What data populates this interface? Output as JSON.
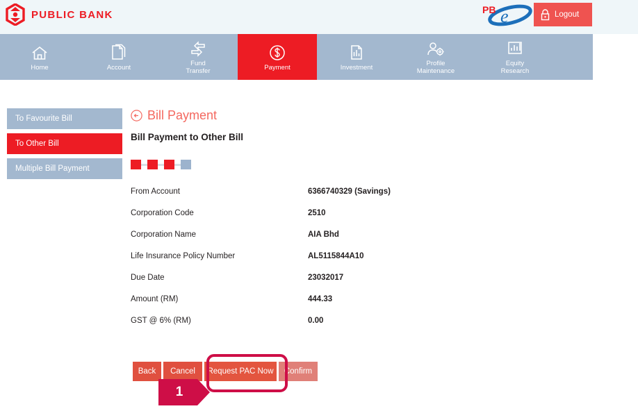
{
  "header": {
    "brand_name": "PUBLIC BANK",
    "brand_logo_icon": "public-bank-diamond-logo",
    "pbe_logo_pb": "PB",
    "pbe_logo_e": "e",
    "logout_label": "Logout",
    "logout_icon": "lock-icon"
  },
  "nav": {
    "items": [
      {
        "label": "Home",
        "icon": "home-icon",
        "active": false
      },
      {
        "label": "Account",
        "icon": "documents-icon",
        "active": false
      },
      {
        "label": "Fund\nTransfer",
        "icon": "transfer-arrows-icon",
        "active": false
      },
      {
        "label": "Payment",
        "icon": "dollar-circle-icon",
        "active": true
      },
      {
        "label": "Investment",
        "icon": "chart-document-icon",
        "active": false
      },
      {
        "label": "Profile\nMaintenance",
        "icon": "user-gear-icon",
        "active": false
      },
      {
        "label": "Equity\nResearch",
        "icon": "bar-chart-icon",
        "active": false
      }
    ]
  },
  "sidebar": {
    "items": [
      {
        "label": "To Favourite Bill",
        "active": false
      },
      {
        "label": "To Other Bill",
        "active": true
      },
      {
        "label": "Multiple Bill Payment",
        "active": false
      }
    ]
  },
  "main": {
    "back_icon": "back-arrow-circle-icon",
    "title": "Bill Payment",
    "subtitle": "Bill Payment to Other Bill",
    "steps": [
      {
        "state": "done"
      },
      {
        "state": "done"
      },
      {
        "state": "done"
      },
      {
        "state": "pending"
      }
    ],
    "fields": [
      {
        "label": "From Account",
        "value": "6366740329  (Savings)"
      },
      {
        "label": "Corporation Code",
        "value": "2510"
      },
      {
        "label": "Corporation Name",
        "value": "AIA Bhd"
      },
      {
        "label": "Life Insurance Policy Number",
        "value": "AL5115844A10"
      },
      {
        "label": "Due Date",
        "value": "23032017"
      },
      {
        "label": "Amount (RM)",
        "value": "444.33"
      },
      {
        "label": "GST @ 6% (RM)",
        "value": "0.00"
      }
    ],
    "buttons": {
      "back": "Back",
      "cancel": "Cancel",
      "request_pac": "Request PAC Now",
      "confirm": "Confirm"
    }
  },
  "annotation": {
    "step_number": "1",
    "highlight_color": "#ce0e47"
  },
  "colors": {
    "brand_red": "#ed1c24",
    "nav_inactive": "#a3b8cf",
    "button_red": "#e0503f",
    "button_disabled": "#e08078",
    "header_bg": "#eff6f9"
  }
}
